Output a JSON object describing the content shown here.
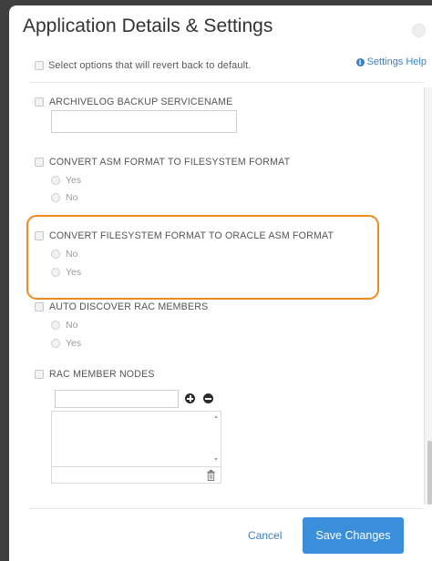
{
  "dialog": {
    "title": "Application Details & Settings",
    "revert_label": "Select options that will revert back to default.",
    "help_link": "Settings Help"
  },
  "settings": {
    "archivelog": {
      "label": "ARCHIVELOG BACKUP SERVICENAME",
      "value": ""
    },
    "convert_asm_to_fs": {
      "label": "CONVERT ASM FORMAT TO FILESYSTEM FORMAT",
      "options": [
        "Yes",
        "No"
      ]
    },
    "convert_fs_to_asm": {
      "label": "CONVERT FILESYSTEM FORMAT TO ORACLE ASM FORMAT",
      "options": [
        "No",
        "Yes"
      ]
    },
    "auto_discover": {
      "label": "AUTO DISCOVER RAC MEMBERS",
      "options": [
        "No",
        "Yes"
      ]
    },
    "rac_member_nodes": {
      "label": "RAC MEMBER NODES",
      "input_value": ""
    }
  },
  "footer": {
    "cancel_label": "Cancel",
    "save_label": "Save Changes"
  },
  "colors": {
    "accent": "#3b8fda",
    "highlight": "#f08a21",
    "link": "#3a82c4"
  }
}
